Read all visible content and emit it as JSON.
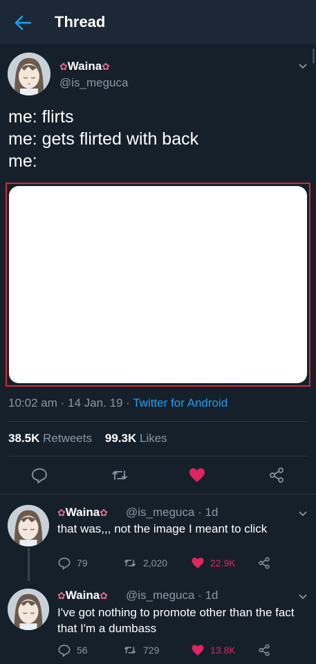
{
  "header": {
    "title": "Thread"
  },
  "tweet": {
    "display_name": "Waina",
    "flower_glyph": "✿",
    "handle": "@is_meguca",
    "lines": [
      "me: flirts",
      "me: gets flirted with back",
      "me:"
    ],
    "time": "10:02 am",
    "date": "14 Jan. 19",
    "source": "Twitter for Android",
    "retweets": "38.5K",
    "retweets_label": "Retweets",
    "likes": "99.3K",
    "likes_label": "Likes"
  },
  "replies": [
    {
      "display_name": "Waina",
      "handle": "@is_meguca",
      "age": "1d",
      "text": "that was,,, not the image I meant to click",
      "reply_count": "79",
      "retweet_count": "2,020",
      "like_count": "22.9K"
    },
    {
      "display_name": "Waina",
      "handle": "@is_meguca",
      "age": "1d",
      "text": "I've got nothing to promote other than the fact that I'm a dumbass",
      "reply_count": "56",
      "retweet_count": "729",
      "like_count": "13.8K"
    }
  ],
  "colors": {
    "background": "#15202b",
    "header": "#1c2836",
    "accent": "#1da1f2",
    "like": "#e0245e",
    "secondary_text": "#8899a6",
    "media_border": "#d42a32"
  },
  "icons": [
    "back-arrow-icon",
    "chevron-down-icon",
    "reply-icon",
    "retweet-icon",
    "heart-icon",
    "share-icon",
    "flower-icon"
  ]
}
